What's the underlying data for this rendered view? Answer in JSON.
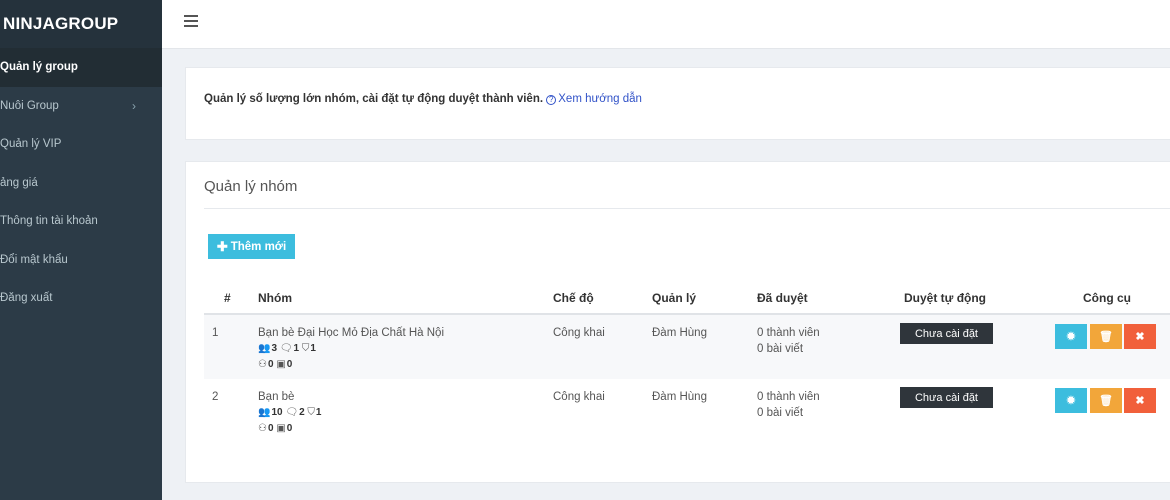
{
  "brand": "NINJAGROUP",
  "sidebar": {
    "items": [
      {
        "label": "Quản lý group"
      },
      {
        "label": "Nuôi Group"
      },
      {
        "label": "Quản lý VIP"
      },
      {
        "label": "ảng giá"
      },
      {
        "label": "Thông tin tài khoản"
      },
      {
        "label": "Đổi mật khẩu"
      },
      {
        "label": "Đăng xuất"
      }
    ],
    "chevron": "›"
  },
  "info": {
    "text": "Quản lý số lượng lớn nhóm, cài đặt tự động duyệt thành viên.",
    "link": "Xem hướng dẫn"
  },
  "panel": {
    "title": "Quản lý nhóm",
    "add_button": "Thêm mới"
  },
  "table": {
    "headers": {
      "index": "#",
      "group": "Nhóm",
      "mode": "Chế độ",
      "admin": "Quản lý",
      "approved": "Đã duyệt",
      "auto": "Duyệt tự động",
      "tools": "Công cụ"
    },
    "rows": [
      {
        "index": "1",
        "name": "Bạn bè Đại Học Mỏ Địa Chất Hà Nội",
        "members": "3",
        "posts": "1",
        "shields": "1",
        "users": "0",
        "images": "0",
        "mode": "Công khai",
        "admin": "Đàm Hùng",
        "approved_members": "0 thành viên",
        "approved_posts": "0 bài viết",
        "auto_status": "Chưa cài đặt"
      },
      {
        "index": "2",
        "name": "Bạn bè",
        "members": "10",
        "posts": "2",
        "shields": "1",
        "users": "0",
        "images": "0",
        "mode": "Công khai",
        "admin": "Đàm Hùng",
        "approved_members": "0 thành viên",
        "approved_posts": "0 bài viết",
        "auto_status": "Chưa cài đặt"
      }
    ]
  },
  "colors": {
    "sidebar": "#2c3b47",
    "accent": "#3cbdde",
    "warning": "#f2a63a",
    "danger": "#f1603b",
    "badge": "#2f353b"
  }
}
